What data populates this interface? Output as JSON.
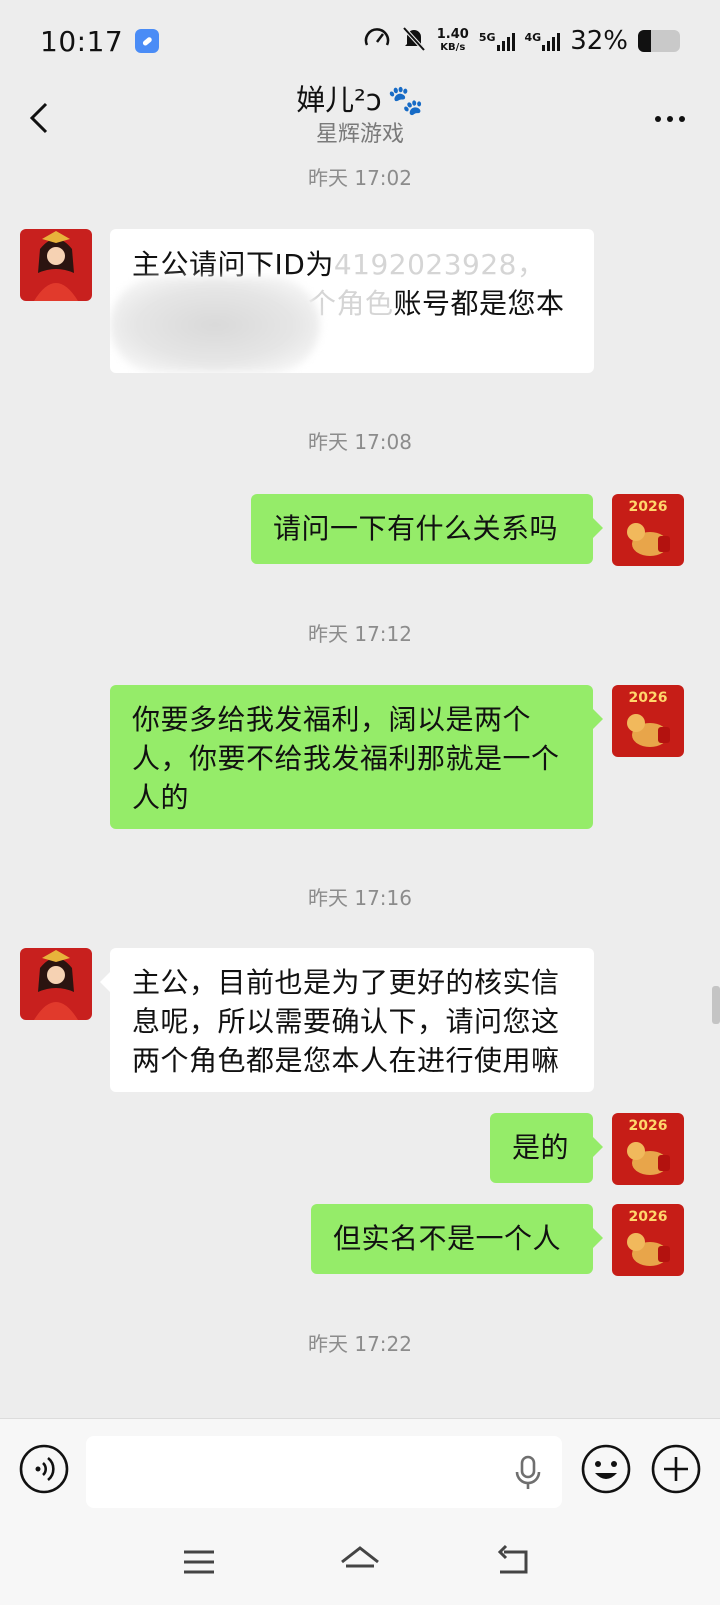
{
  "status_bar": {
    "time": "10:17",
    "speed_value": "1.40",
    "speed_unit": "KB/s",
    "net1": "5G",
    "net2": "4G",
    "battery": "32%",
    "battery_level": 0.32
  },
  "header": {
    "title": "婵儿²ↄ",
    "title_emoji": "🐾",
    "subtitle": "星辉游戏"
  },
  "messages": [
    {
      "type": "timestamp",
      "text": "昨天 17:02"
    },
    {
      "type": "incoming",
      "line1_visible": "主公请问下ID为",
      "line1_faded": "4192023928，",
      "line2_faded": "个角色",
      "line2_visible": "账号都是您本"
    },
    {
      "type": "timestamp",
      "text": "昨天 17:08"
    },
    {
      "type": "outgoing",
      "text": "请问一下有什么关系吗"
    },
    {
      "type": "timestamp",
      "text": "昨天 17:12"
    },
    {
      "type": "outgoing",
      "text": "你要多给我发福利，阔以是两个人，你要不给我发福利那就是一个人的"
    },
    {
      "type": "timestamp",
      "text": "昨天 17:16"
    },
    {
      "type": "incoming",
      "text": "主公，目前也是为了更好的核实信息呢，所以需要确认下，请问您这两个角色都是您本人在进行使用嘛"
    },
    {
      "type": "outgoing",
      "text": "是的"
    },
    {
      "type": "outgoing",
      "text": "但实名不是一个人"
    },
    {
      "type": "timestamp",
      "text": "昨天 17:22"
    }
  ],
  "avatar_badge": "2026",
  "colors": {
    "outgoing_bubble": "#95ec69",
    "incoming_bubble": "#ffffff",
    "background": "#ededed"
  }
}
